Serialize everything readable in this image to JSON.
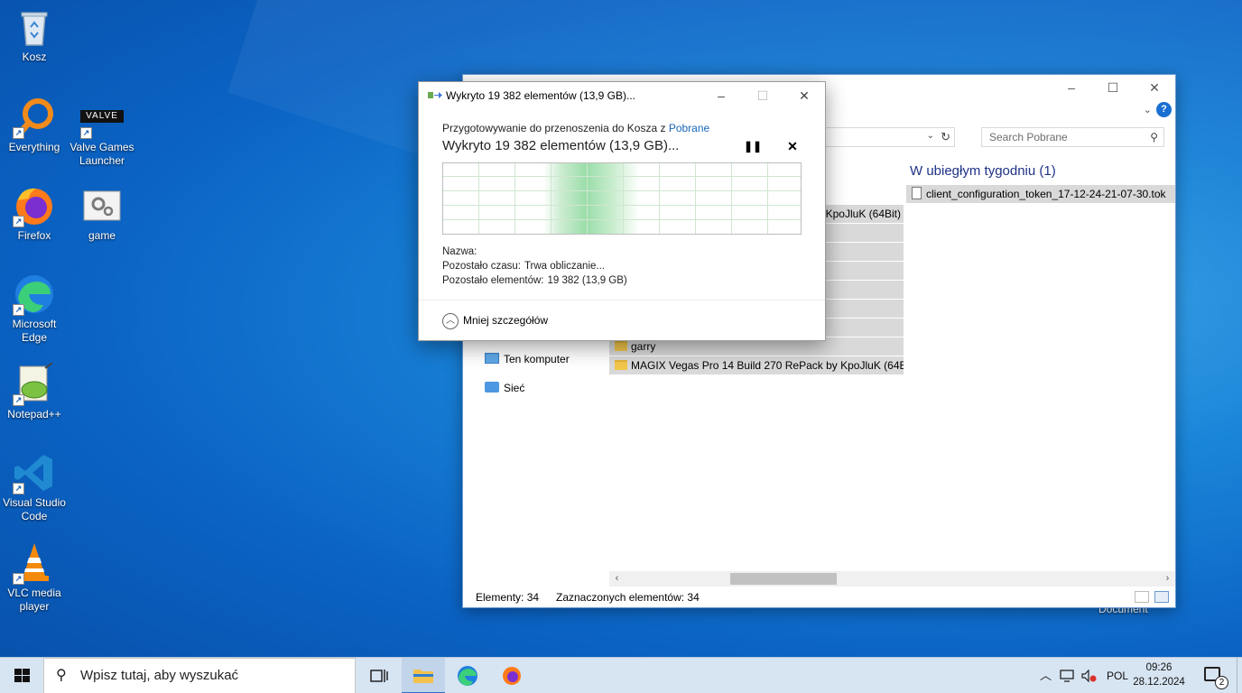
{
  "desktop": {
    "icons": [
      {
        "label": "Kosz",
        "icon": "recycle-bin-icon"
      },
      {
        "label": "Everything",
        "icon": "everything-search-icon"
      },
      {
        "label": "Valve Games Launcher",
        "icon": "valve-icon",
        "logo_text": "VALVE"
      },
      {
        "label": "Firefox",
        "icon": "firefox-icon"
      },
      {
        "label": "game",
        "icon": "gear-settings-icon"
      },
      {
        "label": "Microsoft Edge",
        "icon": "edge-icon"
      },
      {
        "label": "Notepad++",
        "icon": "notepadpp-icon"
      },
      {
        "label": "Visual Studio Code",
        "icon": "vscode-icon"
      },
      {
        "label": "VLC media player",
        "icon": "vlc-cone-icon"
      }
    ],
    "doc_label": "Document"
  },
  "explorer": {
    "search_placeholder": "Search Pobrane",
    "group_header": "W ubiegłym tygodniu (1)",
    "files_right": [
      "client_configuration_token_17-12-24-21-07-30.tok"
    ],
    "files_left_visible": [
      "KpoJluK (64Bit)",
      "garry",
      "MAGIX Vegas Pro 14 Build 270 RePack by KpoJluK (64Bit)"
    ],
    "nav": [
      {
        "label": "Ten komputer"
      },
      {
        "label": "Sieć"
      }
    ],
    "status": {
      "items": "Elementy: 34",
      "selected": "Zaznaczonych elementów: 34"
    }
  },
  "dialog": {
    "title": "Wykryto 19 382 elementów (13,9 GB)...",
    "subtitle_prefix": "Przygotowywanie do przenoszenia do Kosza z",
    "subtitle_link": "Pobrane",
    "main": "Wykryto 19 382 elementów (13,9 GB)...",
    "pause_glyph": "❚❚",
    "stop_glyph": "✕",
    "details": [
      {
        "label": "Nazwa:",
        "value": ""
      },
      {
        "label": "Pozostało czasu:",
        "value": "Trwa obliczanie..."
      },
      {
        "label": "Pozostało elementów:",
        "value": "19 382 (13,9 GB)"
      }
    ],
    "less_details": "Mniej szczegółów"
  },
  "taskbar": {
    "search_placeholder": "Wpisz tutaj, aby wyszukać",
    "language": "POL",
    "time": "09:26",
    "date": "28.12.2024",
    "notification_count": "2"
  },
  "colors": {
    "accent": "#1a66b8",
    "taskbar": "#d7e4f2",
    "selection": "#d9d9d9"
  }
}
